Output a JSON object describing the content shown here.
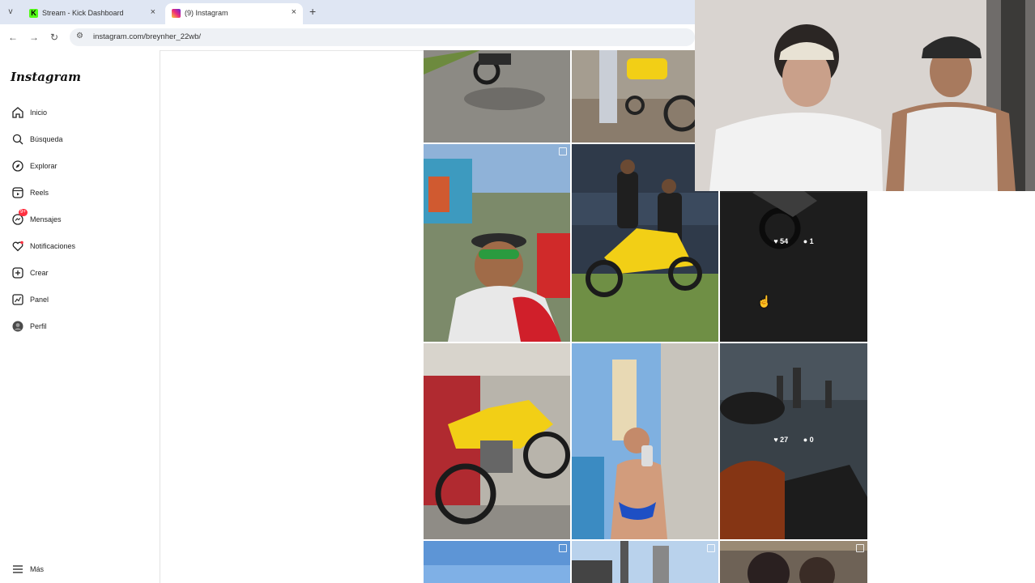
{
  "browser": {
    "tab_menu": "v",
    "tabs": [
      {
        "title": "Stream - Kick Dashboard",
        "close": "×",
        "favicon_color": "#53fc18"
      },
      {
        "title": "(9) Instagram",
        "close": "×",
        "favicon_color": "#e1306c"
      }
    ],
    "new_tab": "+",
    "back": "←",
    "forward": "→",
    "reload": "↻",
    "url": "instagram.com/breynher_22wb/"
  },
  "sidebar": {
    "logo": "Instagram",
    "items": [
      {
        "label": "Inicio",
        "icon": "home-icon"
      },
      {
        "label": "Búsqueda",
        "icon": "search-icon"
      },
      {
        "label": "Explorar",
        "icon": "compass-icon"
      },
      {
        "label": "Reels",
        "icon": "reels-icon"
      },
      {
        "label": "Mensajes",
        "icon": "messenger-icon",
        "badge": "9+"
      },
      {
        "label": "Notificaciones",
        "icon": "heart-icon"
      },
      {
        "label": "Crear",
        "icon": "plus-square-icon"
      },
      {
        "label": "Panel",
        "icon": "chart-icon"
      },
      {
        "label": "Perfil",
        "icon": "avatar-icon"
      }
    ],
    "more": "Más"
  },
  "posts": {
    "hover_1": {
      "likes": "54",
      "comments": "1"
    },
    "hover_2": {
      "likes": "27",
      "comments": "0"
    }
  },
  "colors": {
    "accent": "#ff3040",
    "sidebar_border": "#e2e2e2",
    "bike_yellow": "#f2cf16"
  }
}
